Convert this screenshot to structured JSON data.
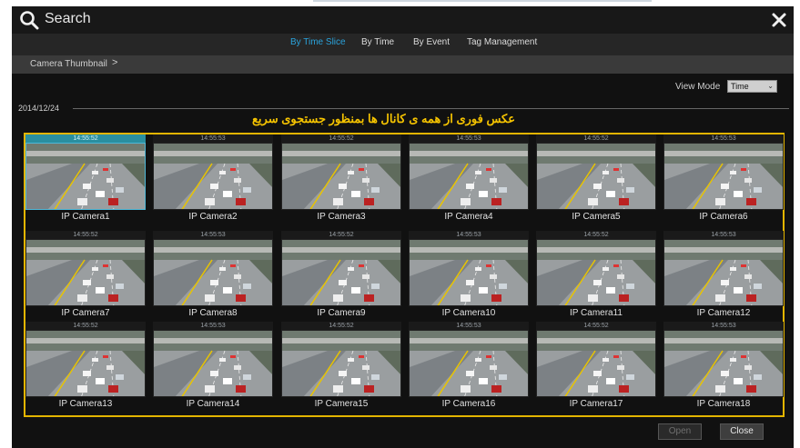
{
  "window": {
    "title": "Search"
  },
  "tabs": [
    {
      "label": "By Time Slice",
      "active": true
    },
    {
      "label": "By Time",
      "active": false
    },
    {
      "label": "By Event",
      "active": false
    },
    {
      "label": "Tag Management",
      "active": false
    }
  ],
  "breadcrumb": {
    "label": "Camera Thumbnail",
    "arrow": ">"
  },
  "view_mode": {
    "label": "View Mode",
    "selected": "Time"
  },
  "date": "2014/12/24",
  "annotation": "عکس فوری از همه ی کانال ها بمنظور جستجوی سریع",
  "cameras": [
    {
      "name": "IP Camera1",
      "time": "14:55:52"
    },
    {
      "name": "IP Camera2",
      "time": "14:55:53"
    },
    {
      "name": "IP Camera3",
      "time": "14:55:52"
    },
    {
      "name": "IP Camera4",
      "time": "14:55:53"
    },
    {
      "name": "IP Camera5",
      "time": "14:55:52"
    },
    {
      "name": "IP Camera6",
      "time": "14:55:53"
    },
    {
      "name": "IP Camera7",
      "time": "14:55:52"
    },
    {
      "name": "IP Camera8",
      "time": "14:55:53"
    },
    {
      "name": "IP Camera9",
      "time": "14:55:52"
    },
    {
      "name": "IP Camera10",
      "time": "14:55:53"
    },
    {
      "name": "IP Camera11",
      "time": "14:55:52"
    },
    {
      "name": "IP Camera12",
      "time": "14:55:53"
    },
    {
      "name": "IP Camera13",
      "time": "14:55:52"
    },
    {
      "name": "IP Camera14",
      "time": "14:55:53"
    },
    {
      "name": "IP Camera15",
      "time": "14:55:52"
    },
    {
      "name": "IP Camera16",
      "time": "14:55:53"
    },
    {
      "name": "IP Camera17",
      "time": "14:55:52"
    },
    {
      "name": "IP Camera18",
      "time": "14:55:53"
    }
  ],
  "buttons": {
    "open": "Open",
    "close": "Close"
  },
  "colors": {
    "accent": "#2aa3dc",
    "annotation": "#f6c400",
    "frame": "#e3b500"
  },
  "icons": {
    "search": "search-icon",
    "close": "close-icon",
    "dropdown": "chevron-down-icon"
  }
}
